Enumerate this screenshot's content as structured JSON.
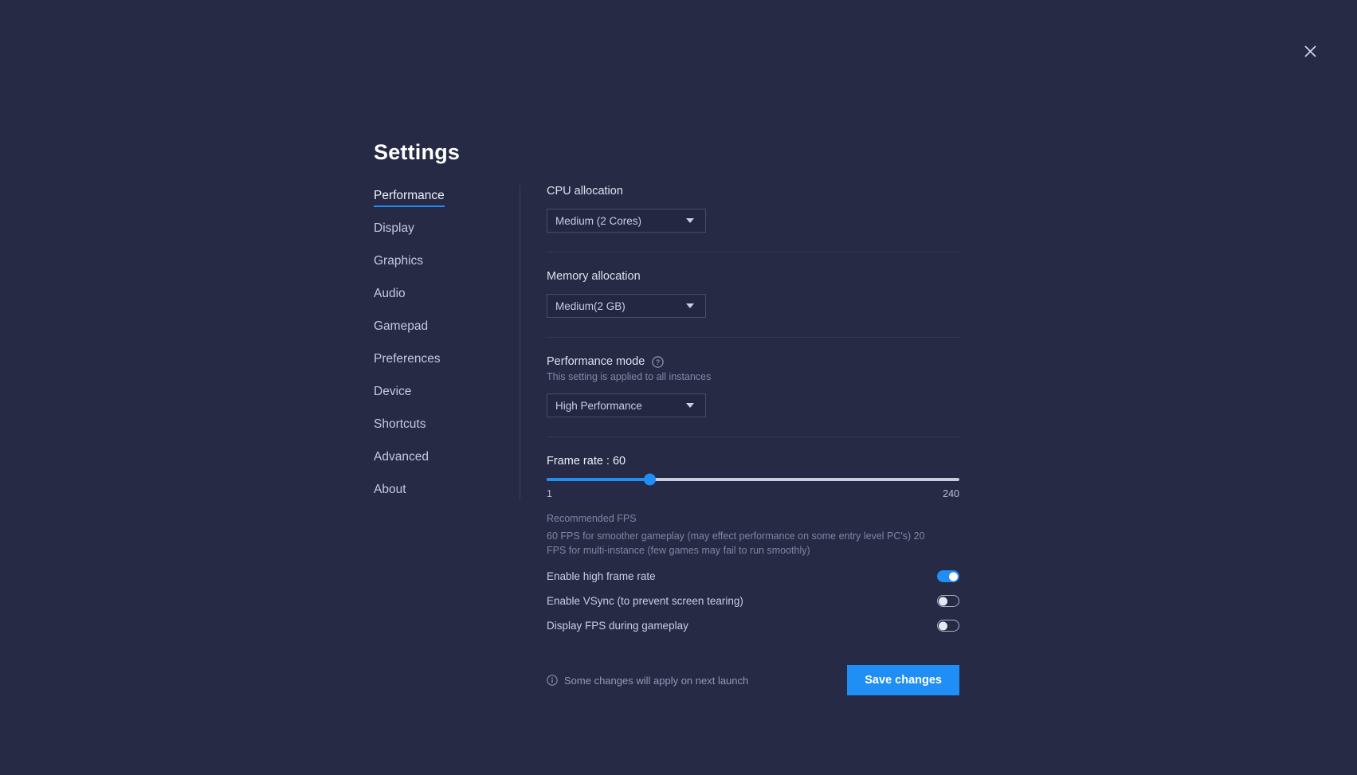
{
  "window": {
    "title": "Settings",
    "close_icon": "close-icon"
  },
  "sidebar": {
    "items": [
      {
        "label": "Performance",
        "active": true
      },
      {
        "label": "Display",
        "active": false
      },
      {
        "label": "Graphics",
        "active": false
      },
      {
        "label": "Audio",
        "active": false
      },
      {
        "label": "Gamepad",
        "active": false
      },
      {
        "label": "Preferences",
        "active": false
      },
      {
        "label": "Device",
        "active": false
      },
      {
        "label": "Shortcuts",
        "active": false
      },
      {
        "label": "Advanced",
        "active": false
      },
      {
        "label": "About",
        "active": false
      }
    ]
  },
  "main": {
    "cpu": {
      "label": "CPU allocation",
      "value": "Medium (2 Cores)"
    },
    "memory": {
      "label": "Memory allocation",
      "value": "Medium(2 GB)"
    },
    "performance_mode": {
      "label": "Performance mode",
      "help_icon": "help-circle-icon",
      "description": "This setting is applied to all instances",
      "value": "High Performance"
    },
    "frame_rate": {
      "title": "Frame rate : 60",
      "value": 60,
      "min_label": "1",
      "max_label": "240",
      "min": 1,
      "max": 240,
      "fill_percent": 25,
      "recommended_title": "Recommended FPS",
      "recommended_text": "60 FPS for smoother gameplay (may effect performance on some entry level PC's) 20 FPS for multi-instance (few games may fail to run smoothly)"
    },
    "toggles": [
      {
        "label": "Enable high frame rate",
        "on": true
      },
      {
        "label": "Enable VSync (to prevent screen tearing)",
        "on": false
      },
      {
        "label": "Display FPS during gameplay",
        "on": false
      }
    ],
    "footer": {
      "info_icon": "info-circle-icon",
      "note": "Some changes will apply on next launch",
      "save_label": "Save changes"
    }
  },
  "colors": {
    "background": "#262a45",
    "accent": "#1f8ef5",
    "text": "#d6dbf0",
    "muted": "#7e85a6"
  }
}
